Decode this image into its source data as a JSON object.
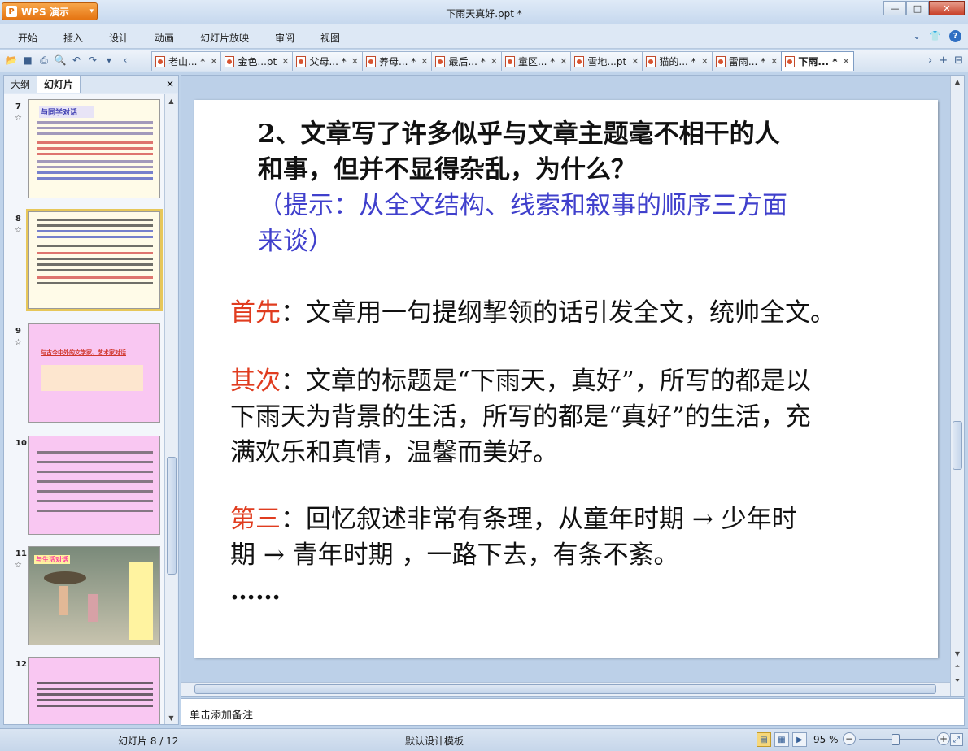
{
  "app": {
    "name": "WPS 演示",
    "window_title": "下雨天真好.ppt *"
  },
  "menu": [
    "开始",
    "插入",
    "设计",
    "动画",
    "幻灯片放映",
    "审阅",
    "视图"
  ],
  "tabs": [
    {
      "label": "老山... *"
    },
    {
      "label": "金色...pt"
    },
    {
      "label": "父母... *"
    },
    {
      "label": "养母... *"
    },
    {
      "label": "最后... *"
    },
    {
      "label": "童区... *"
    },
    {
      "label": "雪地...pt"
    },
    {
      "label": "猫的... *"
    },
    {
      "label": "雷雨... *"
    },
    {
      "label": "下雨... *"
    }
  ],
  "left_panel": {
    "tabs": [
      "大纲",
      "幻灯片"
    ],
    "close": "×",
    "slides": [
      {
        "num": "7",
        "title": "与同学对话"
      },
      {
        "num": "8"
      },
      {
        "num": "9",
        "title": "与古今中外的文学家、艺术家对话"
      },
      {
        "num": "10"
      },
      {
        "num": "11",
        "title": "与生活对话"
      },
      {
        "num": "12"
      }
    ]
  },
  "slide": {
    "question_l1": "2、文章写了许多似乎与文章主题毫不相干的人",
    "question_l2": "和事，但并不显得杂乱，为什么？",
    "hint_l1": "（提示：从全文结构、线索和叙事的顺序三方面",
    "hint_l2": "来谈）",
    "first_label": "首先",
    "first_text": "：文章用一句提纲挈领的话引发全文，统帅全文。",
    "second_label": "其次",
    "second_text_l1": "：文章的标题是“下雨天，真好”，所写的都是以",
    "second_text_l2": "下雨天为背景的生活，所写的都是“真好”的生活，充",
    "second_text_l3": "满欢乐和真情，温馨而美好。",
    "third_label": "第三",
    "third_text_l1": "：回忆叙述非常有条理，从童年时期  → 少年时",
    "third_text_l2": "期  →  青年时期 ，一路下去，有条不紊。",
    "ellipsis": "……"
  },
  "notes_placeholder": "单击添加备注",
  "status": {
    "slide_info": "幻灯片 8 / 12",
    "template": "默认设计模板",
    "zoom": "95 %"
  },
  "colors": {
    "label_red": "#e03c1f",
    "hint_blue": "#4040cc",
    "accent_orange": "#e57412"
  }
}
